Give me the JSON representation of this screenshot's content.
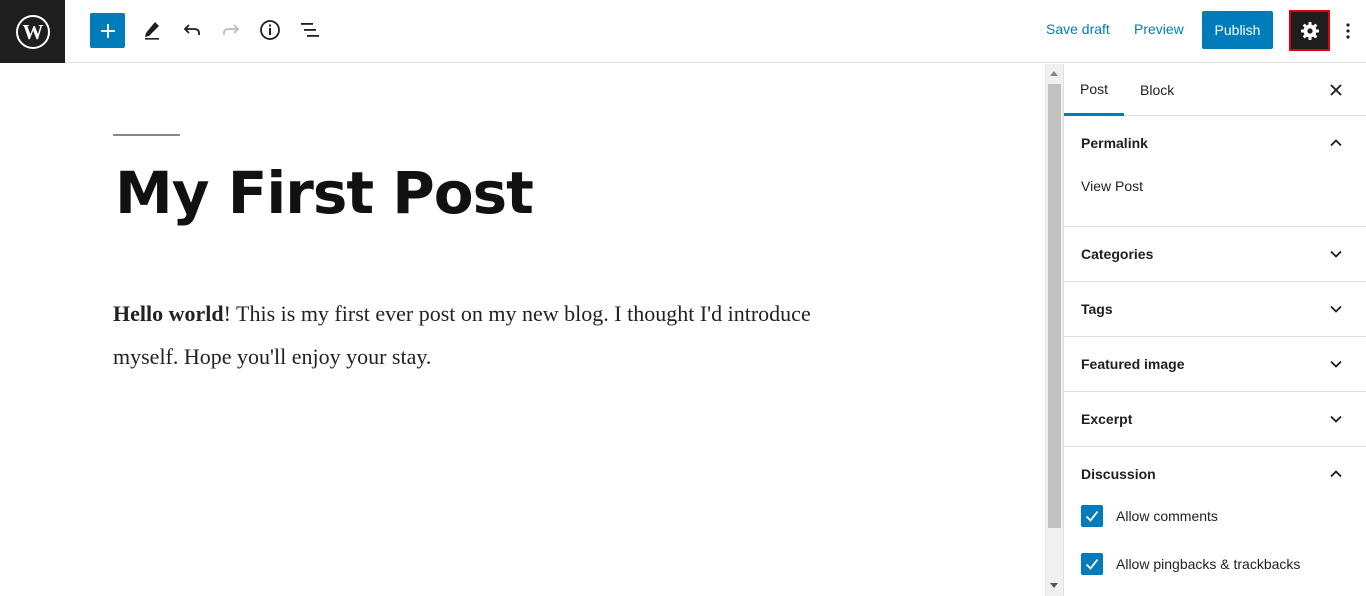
{
  "toolbar": {
    "logo_icon": "wordpress-logo-icon",
    "add_block_icon": "plus-icon",
    "tools_icon": "pencil-icon",
    "undo_icon": "undo-icon",
    "redo_icon": "redo-icon",
    "details_icon": "info-icon",
    "outline_icon": "list-view-icon",
    "save_draft_label": "Save draft",
    "preview_label": "Preview",
    "publish_label": "Publish",
    "settings_icon": "gear-icon",
    "more_icon": "more-vertical-icon"
  },
  "editor": {
    "title": "My First Post",
    "body_bold": "Hello world",
    "body_rest": "! This is my first ever post on my new blog. I thought I'd introduce myself. Hope you'll enjoy your stay."
  },
  "sidebar": {
    "tabs": [
      {
        "label": "Post",
        "active": true
      },
      {
        "label": "Block",
        "active": false
      }
    ],
    "close_icon": "close-icon",
    "panels": {
      "permalink": {
        "title": "Permalink",
        "expanded": true,
        "view_post_label": "View Post"
      },
      "categories": {
        "title": "Categories",
        "expanded": false
      },
      "tags": {
        "title": "Tags",
        "expanded": false
      },
      "featured_image": {
        "title": "Featured image",
        "expanded": false
      },
      "excerpt": {
        "title": "Excerpt",
        "expanded": false
      },
      "discussion": {
        "title": "Discussion",
        "expanded": true,
        "options": [
          {
            "label": "Allow comments",
            "checked": true
          },
          {
            "label": "Allow pingbacks & trackbacks",
            "checked": true
          }
        ]
      }
    }
  },
  "colors": {
    "accent": "#007cba",
    "dark": "#1e1e1e",
    "highlight_border": "#e0000b"
  }
}
